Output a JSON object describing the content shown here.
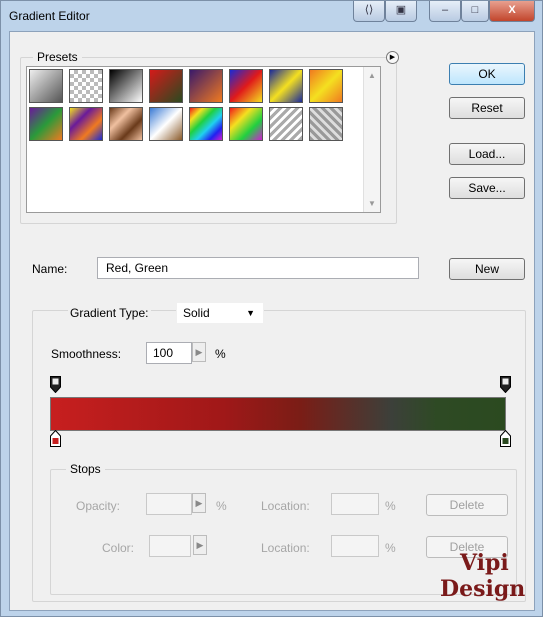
{
  "window": {
    "title": "Gradient Editor",
    "controls": [
      "⟨⟩",
      "▣",
      "–",
      "□",
      "X"
    ]
  },
  "presets": {
    "legend": "Presets",
    "menu_icon": "flyout-arrow-icon",
    "swatches": [
      {
        "name": "black-white",
        "css": "linear-gradient(135deg,#eeeeee,#555555)"
      },
      {
        "name": "transparent-checker",
        "css": "repeating-conic-gradient(#bbb 0 25%, #fff 0 50%) 0 0/8px 8px"
      },
      {
        "name": "black-to-white",
        "css": "linear-gradient(135deg,#000,#fff)"
      },
      {
        "name": "red-green",
        "css": "linear-gradient(135deg,#d41a1a,#2a4a20)"
      },
      {
        "name": "violet-orange",
        "css": "linear-gradient(135deg,#3a1a6a,#f07a20)"
      },
      {
        "name": "blue-red-yellow",
        "css": "linear-gradient(135deg,#1a2ad4,#e01a1a,#f4e020)"
      },
      {
        "name": "blue-yellow-blue",
        "css": "linear-gradient(135deg,#1a2a9a,#f4e020,#1a2a9a)"
      },
      {
        "name": "orange-yellow-orange",
        "css": "linear-gradient(135deg,#f07a20,#f4e020,#f07a20)"
      },
      {
        "name": "violet-green-orange",
        "css": "linear-gradient(135deg,#6a1a9a,#2a9a3a,#f07a20)"
      },
      {
        "name": "yellow-violet-orange-blue",
        "css": "linear-gradient(135deg,#f4e020,#6a1a9a,#f07a20,#1a2ad4)"
      },
      {
        "name": "copper",
        "css": "linear-gradient(135deg,#6a3a1a,#f0c0a0,#6a3a1a,#f0c0a0)"
      },
      {
        "name": "chrome",
        "css": "linear-gradient(135deg,#3a7ad4,#ffffff,#8a5a2a)"
      },
      {
        "name": "spectrum",
        "css": "linear-gradient(135deg,#f01a1a,#f4e020,#20d040,#20d0f0,#2020f0,#d020d0)"
      },
      {
        "name": "transparent-rainbow",
        "css": "linear-gradient(135deg,#f01a1a,#f4e020,#20d040,#d020d0)"
      },
      {
        "name": "transparent-stripes",
        "css": "repeating-linear-gradient(135deg,#aaa 0 3px,#fff 3px 6px)"
      },
      {
        "name": "checker-diagonal",
        "css": "repeating-linear-gradient(45deg,#999 0 3px,#ddd 3px 6px)"
      }
    ]
  },
  "buttons": {
    "ok": "OK",
    "reset": "Reset",
    "load": "Load...",
    "save": "Save...",
    "new": "New",
    "delete_opacity": "Delete",
    "delete_color": "Delete"
  },
  "name_field": {
    "label": "Name:",
    "value": "Red, Green"
  },
  "gradient": {
    "type_label": "Gradient Type:",
    "type_value": "Solid",
    "smoothness_label": "Smoothness:",
    "smoothness_value": "100",
    "smoothness_unit": "%",
    "colors": {
      "start": "#c71f1f",
      "end": "#2b4a20"
    }
  },
  "stops": {
    "legend": "Stops",
    "opacity_label": "Opacity:",
    "opacity_unit": "%",
    "location_label_1": "Location:",
    "location_unit_1": "%",
    "color_label": "Color:",
    "location_label_2": "Location:",
    "location_unit_2": "%"
  },
  "watermark": {
    "line1": "Vipi",
    "line2": "Design"
  }
}
